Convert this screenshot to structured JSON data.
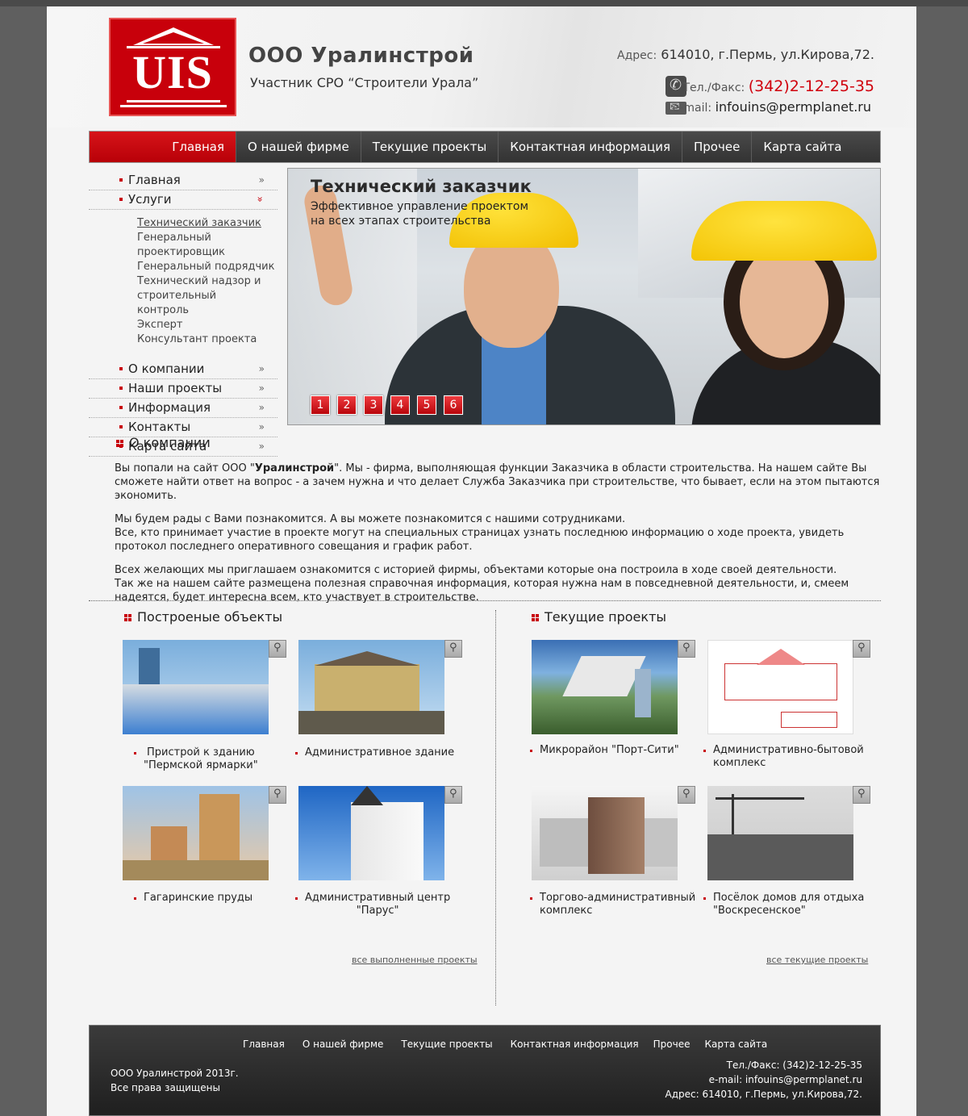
{
  "header": {
    "logo_text": "UIS",
    "company_name": "ООО Уралинстрой",
    "company_subtitle": "Участник СРО “Строители Урала”",
    "address_label": "Адрес:",
    "address_value": "614010, г.Пермь, ул.Кирова,72.",
    "phone_label": "Тел./Факс:",
    "phone_value": "(342)2-12-25-35",
    "email_label": "e-mail:",
    "email_value": "infouins@permplanet.ru"
  },
  "topnav": {
    "items": [
      "Главная",
      "О нашей фирме",
      "Текущие проекты",
      "Контактная информация",
      "Прочее",
      "Карта сайта"
    ],
    "active_index": 0
  },
  "sidebar": {
    "items": [
      "Главная",
      "Услуги",
      "О компании",
      "Наши проекты",
      "Информация",
      "Контакты",
      "Карта сайта"
    ],
    "arrow": "»",
    "arrow_open": "»",
    "submenu": [
      "Технический заказчик",
      "Генеральный проектировщик",
      "Генеральный подрядчик",
      "Технический надзор и строительный контроль",
      "Эксперт",
      "Консультант проекта"
    ]
  },
  "banner": {
    "title": "Технический заказчик",
    "subtitle_line1": "Эффективное управление проектом",
    "subtitle_line2": "на всех этапах строительства",
    "pages": [
      "1",
      "2",
      "3",
      "4",
      "5",
      "6"
    ]
  },
  "about": {
    "title": "О компании",
    "p1_before": "Вы попали на сайт ООО \"",
    "p1_bold": "Уралинстрой",
    "p1_after": "\". Мы - фирма, выполняющая функции Заказчика в области строительства. На нашем сайте Вы сможете найти ответ на вопрос - а зачем нужна и что делает Служба Заказчика при строительстве, что бывает, если на этом пытаются экономить.",
    "p2_line1": "Мы будем рады с Вами познакомится. А вы можете познакомится с нашими сотрудниками.",
    "p2_line2": "Все, кто принимает участие в проекте могут на специальных страницах узнать последнюю информацию о ходе проекта, увидеть протокол последнего оперативного совещания и график работ.",
    "p3_line1": "Всех желающих мы приглашаем ознакомится с историей фирмы, объектами которые она построила в ходе своей деятельности.",
    "p3_line2": "Так же на нашем сайте размещена полезная справочная информация, которая нужна нам в повседневной деятельности, и, смеем надеятся, будет интересна всем, кто участвует в строительстве."
  },
  "built": {
    "title": "Построеные объекты",
    "items": [
      {
        "line1": "Пристрой к зданию",
        "line2": "\"Пермской ярмарки\""
      },
      {
        "line1": "Административное здание",
        "line2": ""
      },
      {
        "line1": "Гагаринские пруды",
        "line2": ""
      },
      {
        "line1": "Административный центр",
        "line2": "\"Парус\""
      }
    ],
    "more": "все выполненные проекты"
  },
  "current": {
    "title": "Текущие проекты",
    "items": [
      {
        "line1": "Микрорайон \"Порт-Сити\"",
        "line2": ""
      },
      {
        "line1": "Административно-бытовой",
        "line2": "комплекс"
      },
      {
        "line1": "Торгово-административный",
        "line2": "комплекс"
      },
      {
        "line1": "Посёлок домов для отдыха",
        "line2": "\"Воскресенское\""
      }
    ],
    "more": "все текущие проекты"
  },
  "footer": {
    "nav": [
      "Главная",
      "О нашей фирме",
      "Текущие проекты",
      "Контактная информация",
      "Прочее",
      "Карта сайта"
    ],
    "copy_line1": "ООО Уралинстрой  2013г.",
    "copy_line2": "Все права защищены",
    "phone": "Тел./Факс: (342)2-12-25-35",
    "email": "e-mail: infouins@permplanet.ru",
    "address": "Адрес: 614010, г.Пермь, ул.Кирова,72."
  },
  "colors": {
    "brand_red": "#c8000b",
    "nav_dark": "#3a3a3a",
    "page_bg": "#f4f4f4",
    "outer_bg": "#5f5f5f"
  },
  "icons": [
    "phone-icon",
    "mail-icon",
    "zoom-icon",
    "bullet-icon",
    "double-chevron-icon"
  ]
}
